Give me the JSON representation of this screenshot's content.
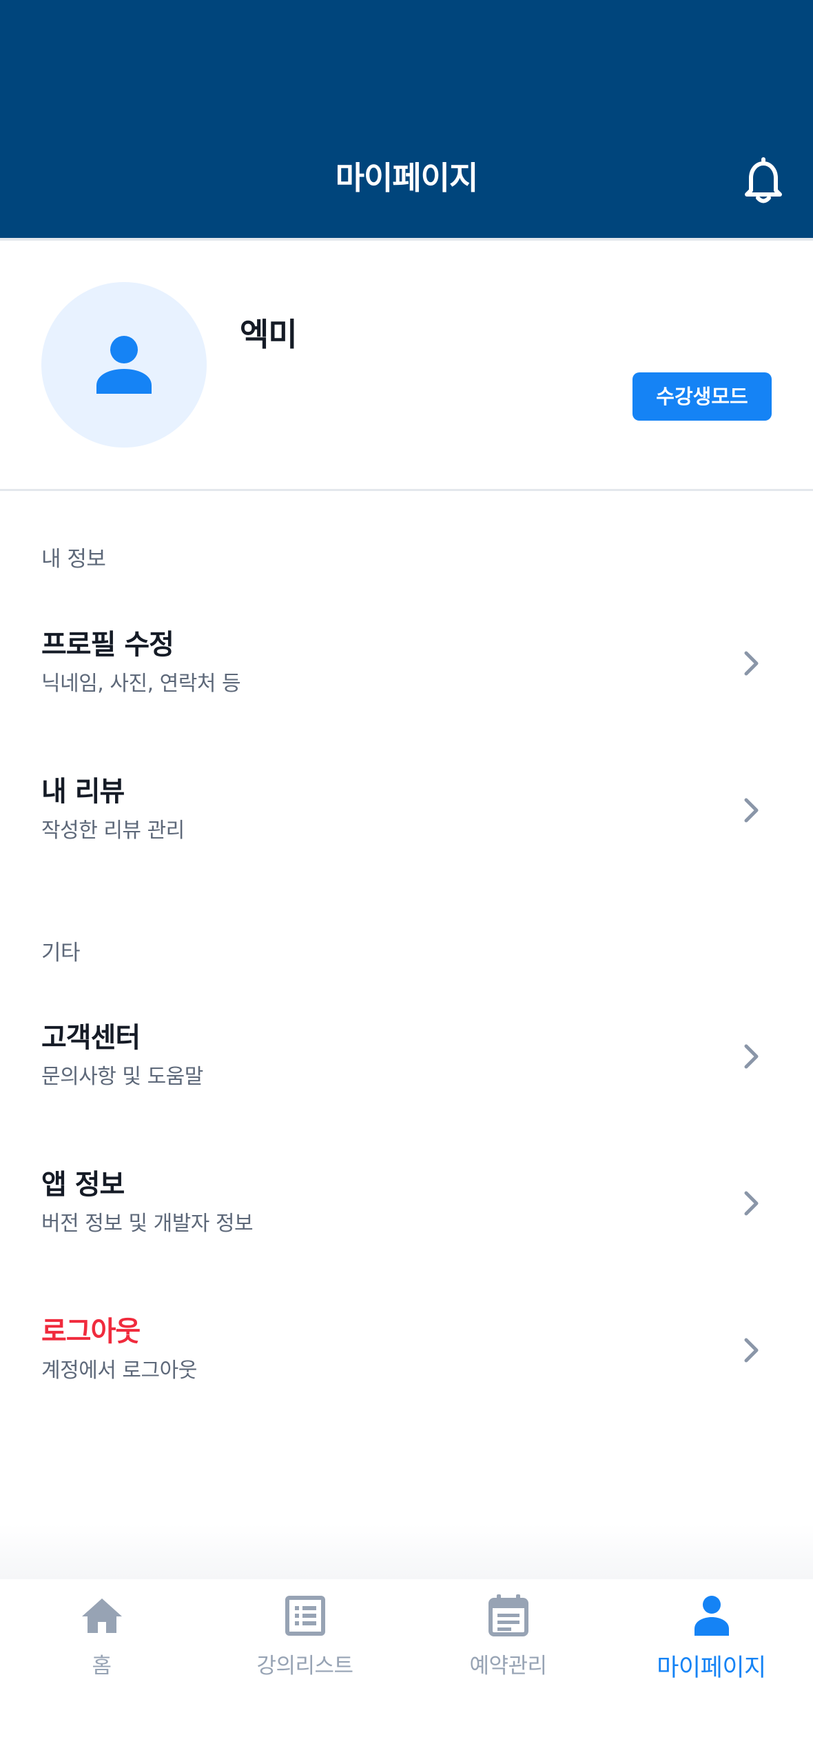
{
  "header": {
    "title": "마이페이지",
    "icon": "bell-icon"
  },
  "profile": {
    "name": "엑미",
    "avatar_icon": "person-icon",
    "mode_button": "수강생모드"
  },
  "sections": [
    {
      "label": "내 정보",
      "items": [
        {
          "title": "프로필 수정",
          "subtitle": "닉네임, 사진, 연락처 등"
        },
        {
          "title": "내 리뷰",
          "subtitle": "작성한 리뷰 관리"
        }
      ]
    },
    {
      "label": "기타",
      "items": [
        {
          "title": "고객센터",
          "subtitle": "문의사항 및 도움말"
        },
        {
          "title": "앱 정보",
          "subtitle": "버전 정보 및 개발자 정보"
        },
        {
          "title": "로그아웃",
          "subtitle": "계정에서 로그아웃"
        }
      ]
    }
  ],
  "tabbar": {
    "tabs": [
      {
        "label": "홈",
        "icon": "home-icon"
      },
      {
        "label": "강의리스트",
        "icon": "list-icon"
      },
      {
        "label": "예약관리",
        "icon": "calendar-icon"
      },
      {
        "label": "마이페이지",
        "icon": "person-icon",
        "active": true
      }
    ]
  },
  "colors": {
    "header_bg": "#00457c",
    "accent": "#1583f5",
    "danger": "#f02b3d",
    "muted": "#97a3b4"
  }
}
